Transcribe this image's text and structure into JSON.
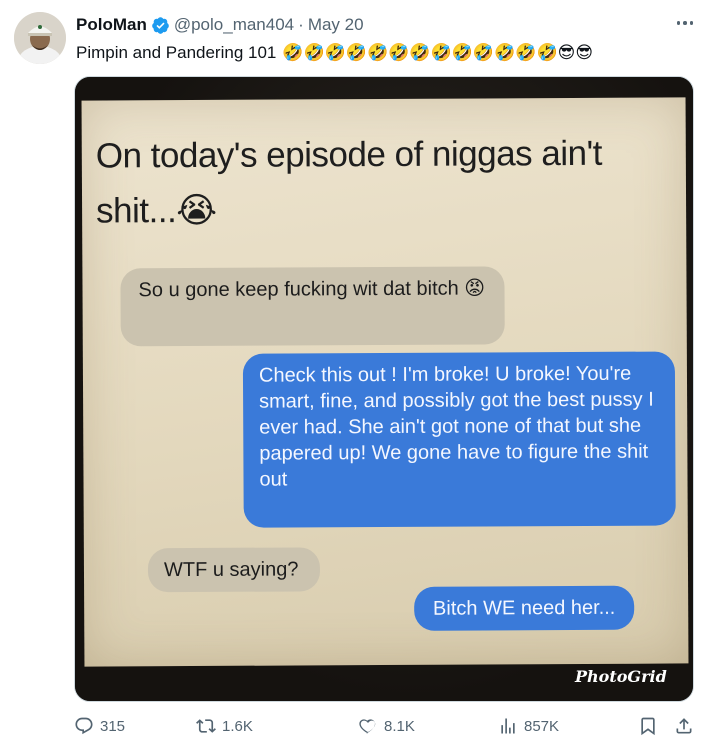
{
  "tweet": {
    "display_name": "PoloMan",
    "handle": "@polo_man404",
    "separator": "·",
    "date": "May 20",
    "text": "Pimpin and Pandering 101",
    "emojis": [
      "🤣",
      "🤣",
      "🤣",
      "🤣",
      "🤣",
      "🤣",
      "🤣",
      "🤣",
      "🤣",
      "🤣",
      "🤣",
      "🤣",
      "🤣",
      "😎",
      "😎"
    ]
  },
  "media": {
    "headline": "On today's episode of niggas ain't shit...😭",
    "messages": [
      {
        "from": "received",
        "text": "So u gone keep fucking wit dat bitch 😡"
      },
      {
        "from": "sent",
        "text": "Check this out ! I'm broke! U broke! You're smart, fine, and possibly got the best pussy I ever had. She ain't got none of that but she papered up! We gone have to figure the shit out"
      },
      {
        "from": "received",
        "text": "WTF u saying?"
      },
      {
        "from": "sent",
        "text": "Bitch WE need her..."
      }
    ],
    "watermark": "PhotoGrid"
  },
  "actions": {
    "replies": "315",
    "reposts": "1.6K",
    "likes": "8.1K",
    "views": "857K"
  },
  "icons": {
    "verified": "verified-badge-icon",
    "more": "more-options-icon",
    "reply": "reply-icon",
    "repost": "repost-icon",
    "like": "heart-icon",
    "views": "views-icon",
    "bookmark": "bookmark-icon",
    "share": "share-icon"
  },
  "colors": {
    "verified": "#1d9bf0",
    "secondary_text": "#536471",
    "sent_bubble": "#3a7ad9",
    "received_bubble": "#cbc3af"
  }
}
